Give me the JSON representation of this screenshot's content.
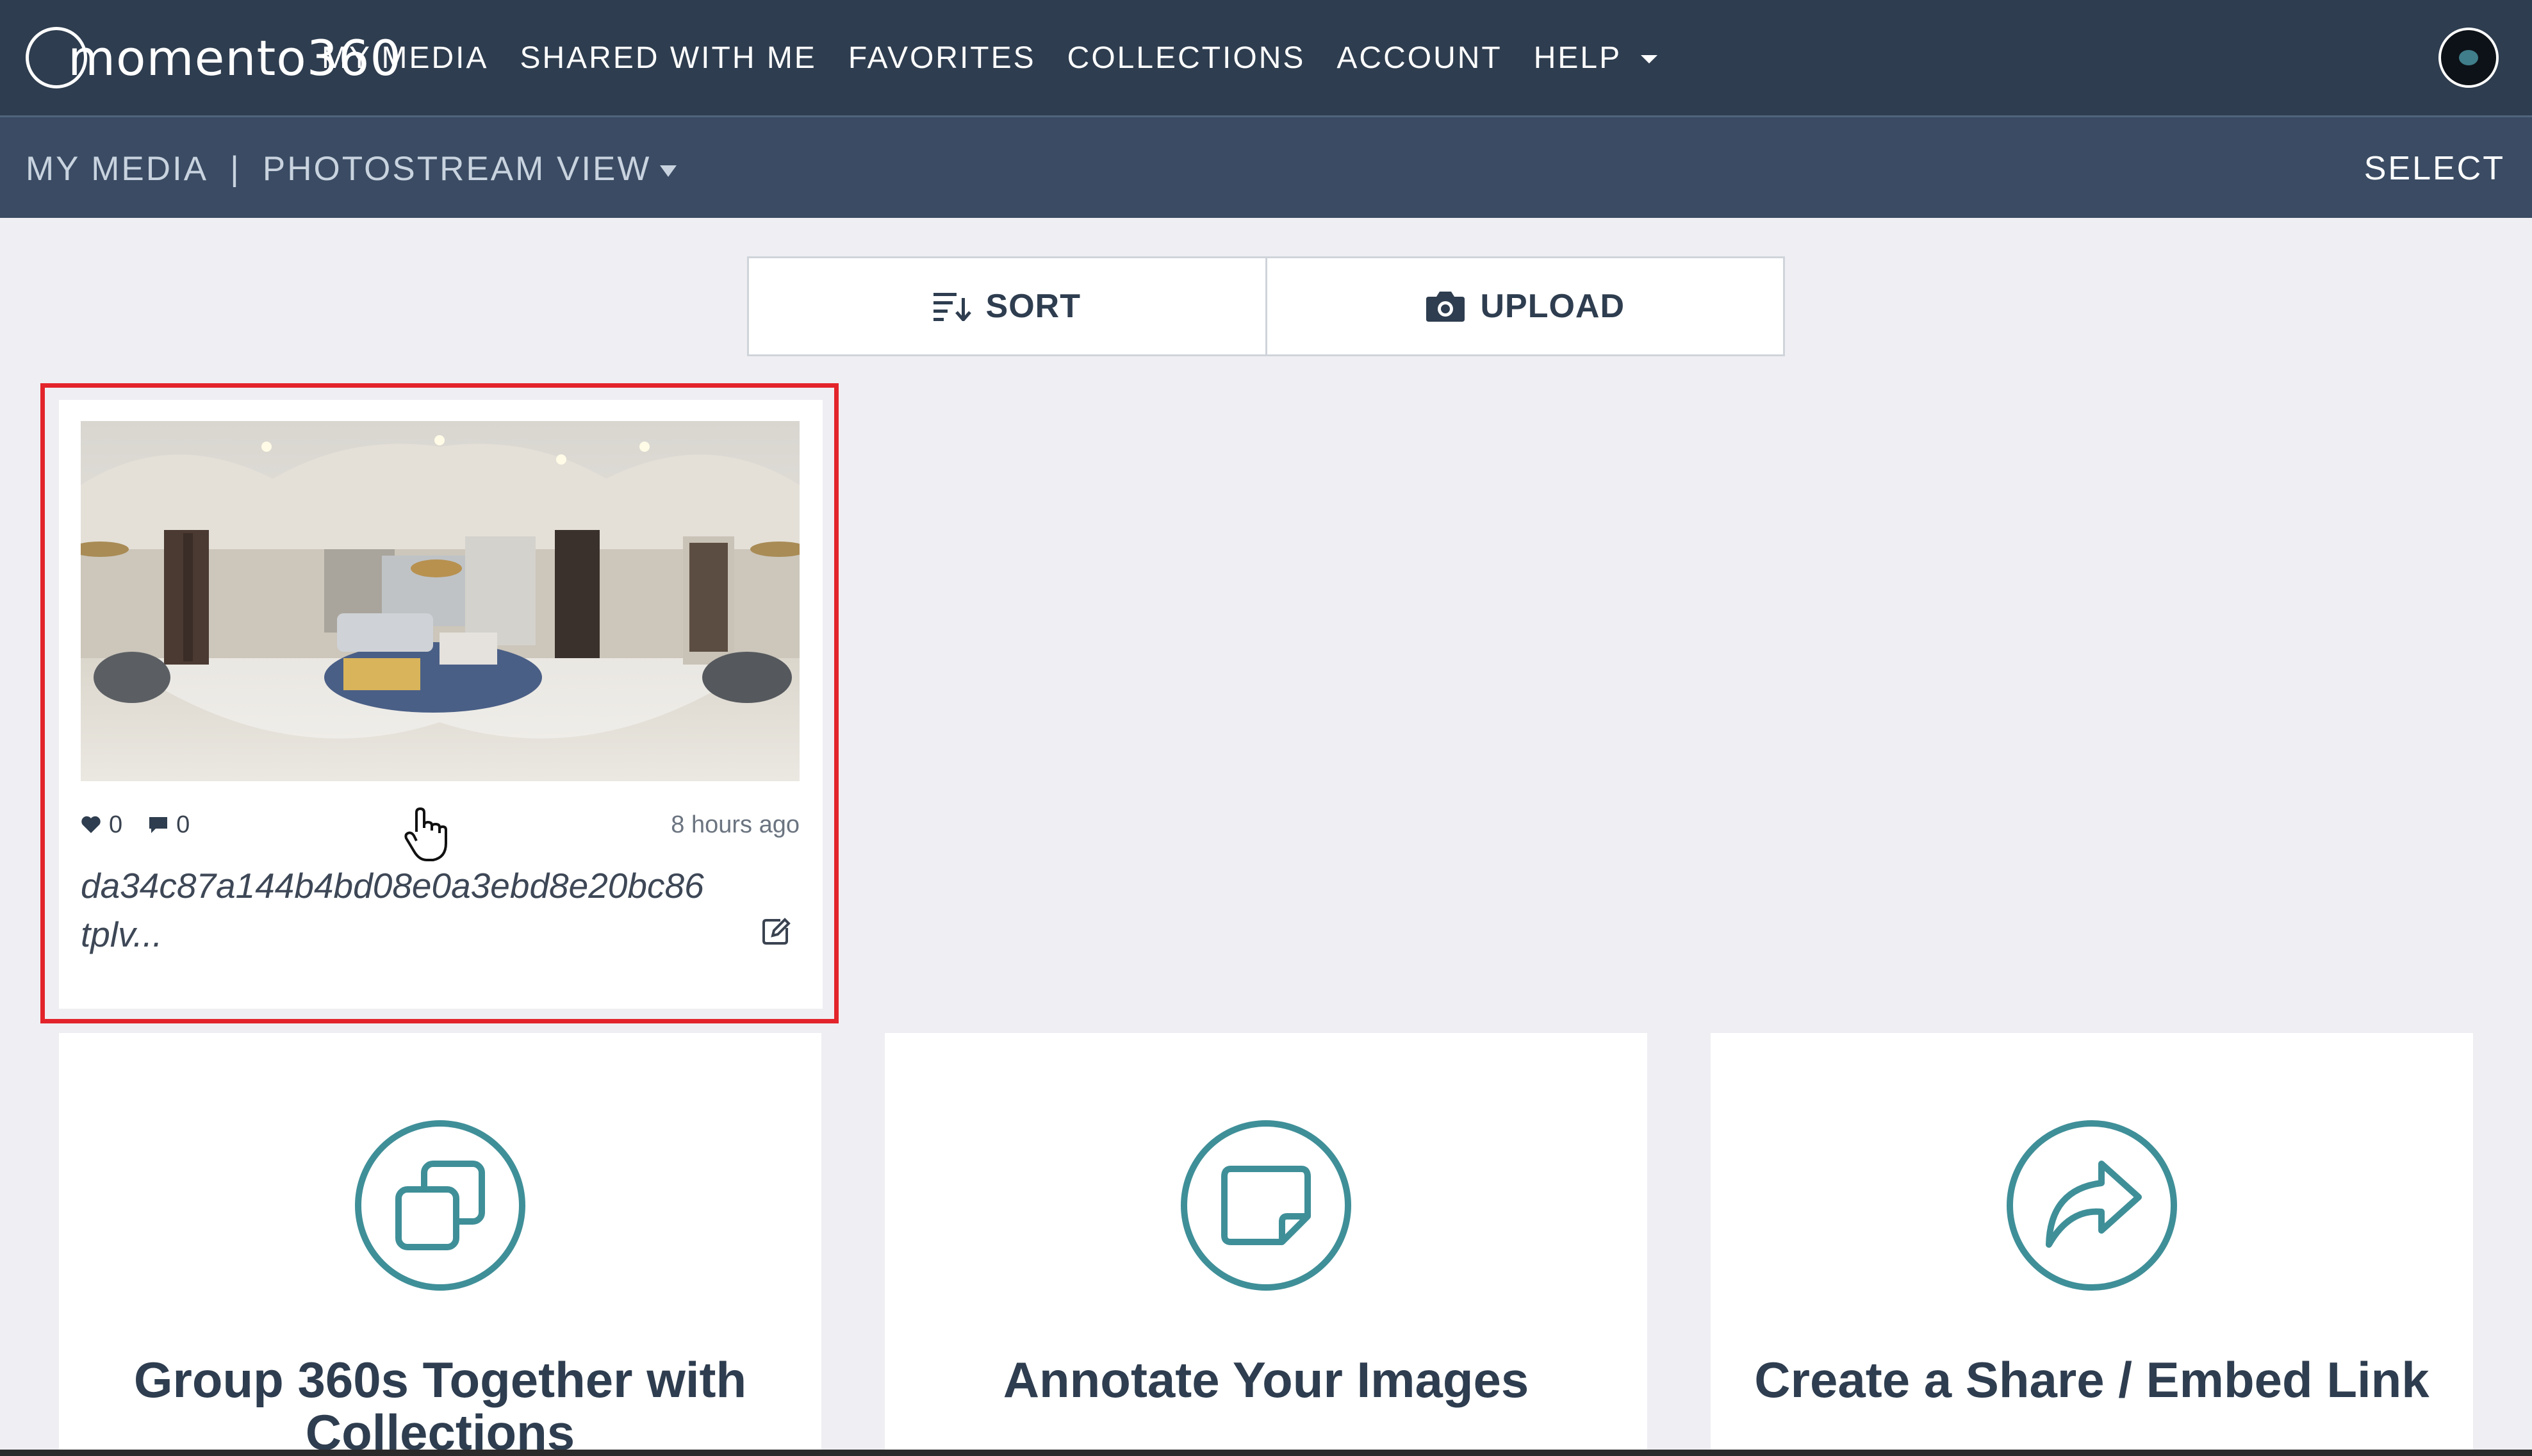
{
  "brand": {
    "logo_text": "momento360"
  },
  "nav": {
    "items": [
      "MY MEDIA",
      "SHARED WITH ME",
      "FAVORITES",
      "COLLECTIONS",
      "ACCOUNT",
      "HELP"
    ]
  },
  "subnav": {
    "section": "MY MEDIA",
    "divider": "|",
    "view": "PHOTOSTREAM VIEW",
    "select": "SELECT"
  },
  "toolbar": {
    "sort_label": "SORT",
    "upload_label": "UPLOAD"
  },
  "media": {
    "likes": "0",
    "comments": "0",
    "time": "8 hours ago",
    "filename_line1": "da34c87a144b4bd08e0a3ebd8e20bc86",
    "filename_line2": "tplv..."
  },
  "features": [
    {
      "title": "Group 360s Together with Collections",
      "icon": "collections-icon"
    },
    {
      "title": "Annotate Your Images",
      "icon": "note-icon"
    },
    {
      "title": "Create a Share / Embed Link",
      "icon": "share-icon"
    }
  ],
  "colors": {
    "nav_bg": "#2e3d4f",
    "subnav_bg": "#3a4b63",
    "page_bg": "#efeff3",
    "accent_teal": "#3f8f98",
    "highlight_red": "#e3242b"
  }
}
